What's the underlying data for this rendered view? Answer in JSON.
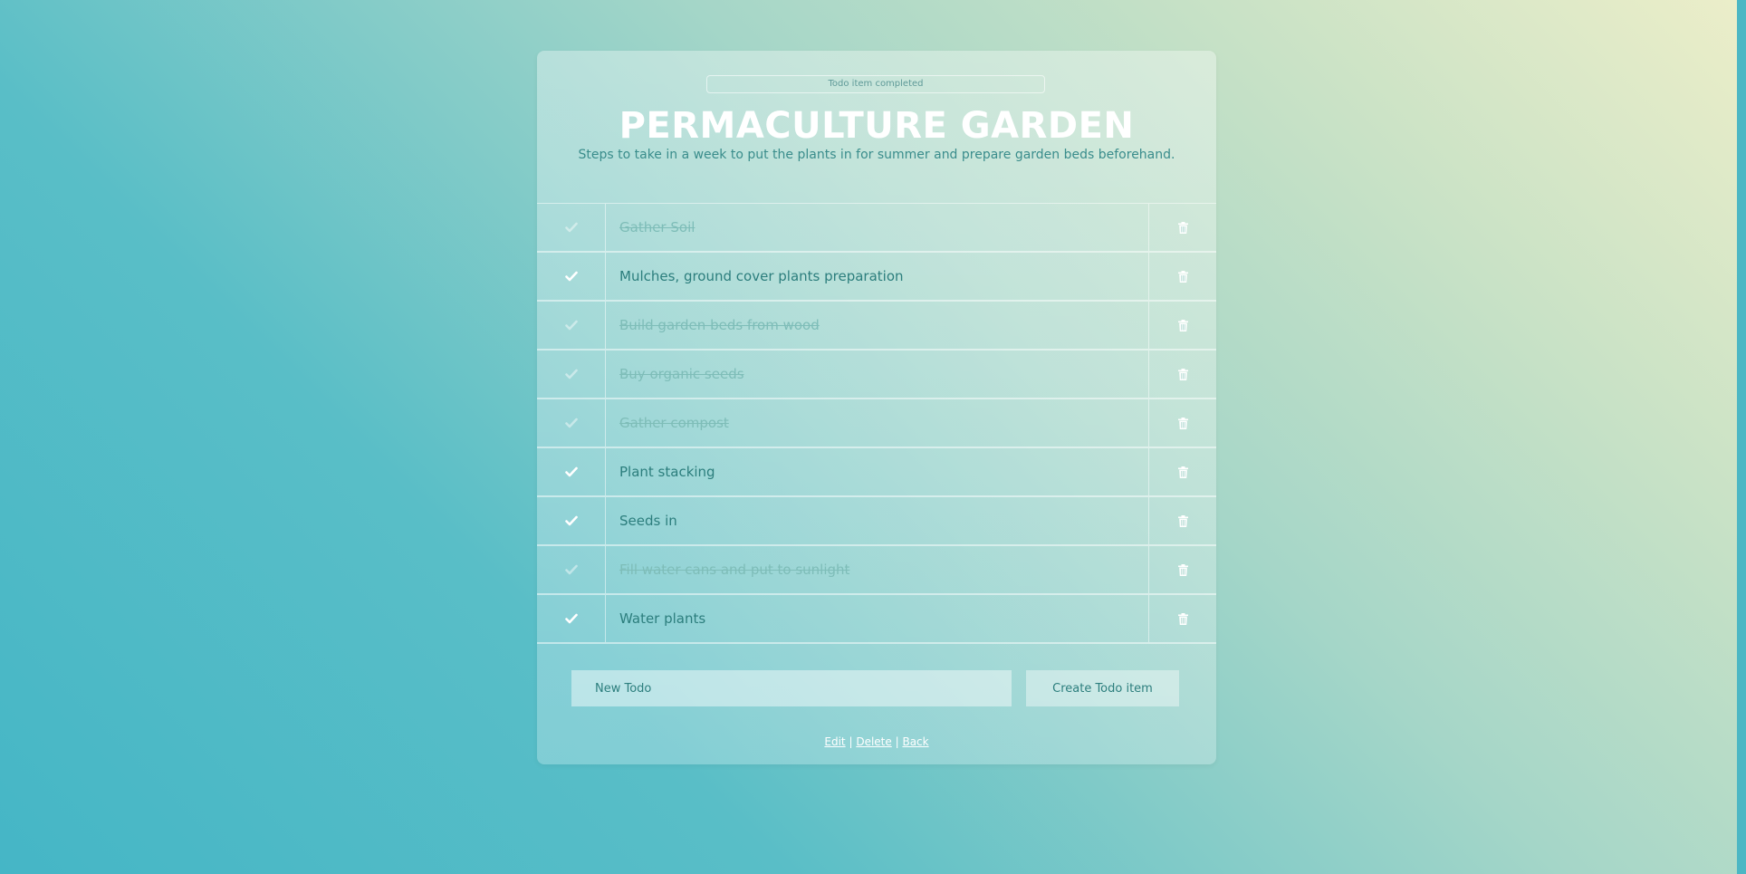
{
  "notice": "Todo item completed",
  "list": {
    "title": "PERMACULTURE GARDEN",
    "description": "Steps to take in a week to put the plants in for summer and prepare garden beds beforehand."
  },
  "todos": [
    {
      "text": "Gather Soil",
      "completed": true
    },
    {
      "text": "Mulches, ground cover plants preparation",
      "completed": false
    },
    {
      "text": "Build garden beds from wood",
      "completed": true
    },
    {
      "text": "Buy organic seeds",
      "completed": true
    },
    {
      "text": "Gather compost",
      "completed": true
    },
    {
      "text": "Plant stacking",
      "completed": false
    },
    {
      "text": "Seeds in",
      "completed": false
    },
    {
      "text": "Fill water cans and put to sunlight",
      "completed": true
    },
    {
      "text": "Water plants",
      "completed": false
    }
  ],
  "form": {
    "placeholder": "New Todo",
    "submit_label": "Create Todo item"
  },
  "footer": {
    "edit_label": "Edit",
    "delete_label": "Delete",
    "back_label": "Back",
    "separator": "|"
  },
  "colors": {
    "text_teal": "#2c7e7d",
    "completed_text": "#7ebdb8",
    "title": "#ffffff"
  },
  "icons": {
    "complete": "check-icon",
    "delete": "trash-icon"
  }
}
